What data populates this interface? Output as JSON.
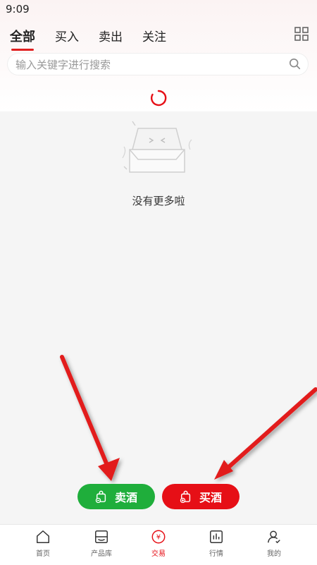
{
  "status_bar": {
    "time": "9:09"
  },
  "tabs": [
    {
      "label": "全部",
      "active": true
    },
    {
      "label": "买入",
      "active": false
    },
    {
      "label": "卖出",
      "active": false
    },
    {
      "label": "关注",
      "active": false
    }
  ],
  "search": {
    "placeholder": "输入关键字进行搜索"
  },
  "empty": {
    "message": "没有更多啦"
  },
  "actions": {
    "sell_label": "卖酒",
    "buy_label": "买酒"
  },
  "bottom_nav": [
    {
      "label": "首页",
      "icon": "home-icon"
    },
    {
      "label": "产品库",
      "icon": "product-library-icon"
    },
    {
      "label": "交易",
      "icon": "trade-icon",
      "active": true
    },
    {
      "label": "行情",
      "icon": "market-icon"
    },
    {
      "label": "我的",
      "icon": "profile-icon"
    }
  ],
  "colors": {
    "accent_red": "#e60f16",
    "accent_green": "#1fae3b",
    "background": "#f5f5f5"
  }
}
